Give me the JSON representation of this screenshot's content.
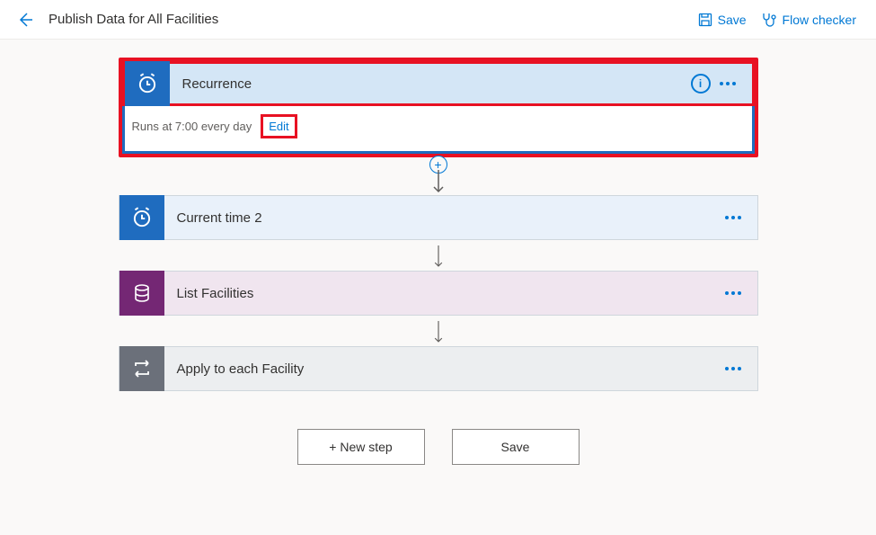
{
  "header": {
    "title": "Publish Data for All Facilities",
    "save_label": "Save",
    "flow_checker_label": "Flow checker"
  },
  "steps": {
    "recurrence": {
      "title": "Recurrence",
      "summary": "Runs at 7:00 every day",
      "edit_label": "Edit"
    },
    "current_time": {
      "title": "Current time 2"
    },
    "list_facilities": {
      "title": "List Facilities"
    },
    "apply_each": {
      "title": "Apply to each Facility"
    }
  },
  "footer": {
    "new_step_label": "+ New step",
    "save_label": "Save"
  },
  "info_glyph": "i"
}
